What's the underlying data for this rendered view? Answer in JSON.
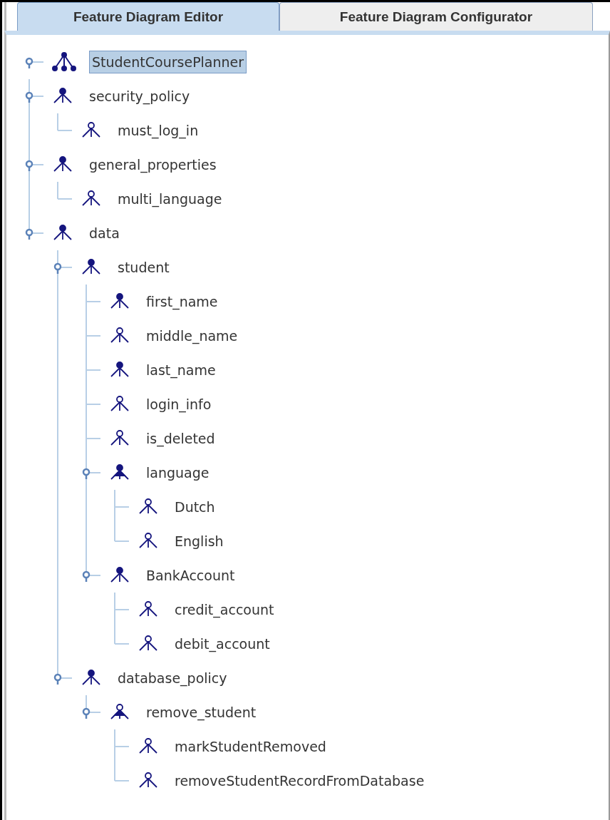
{
  "tabs": [
    {
      "label": "Feature Diagram Editor",
      "selected": true
    },
    {
      "label": "Feature Diagram Configurator",
      "selected": false
    }
  ],
  "tree": {
    "label": "StudentCoursePlanner",
    "kind": "concept",
    "selected": true,
    "expanded": true,
    "children": [
      {
        "label": "security_policy",
        "kind": "mandatory",
        "selected": false,
        "expanded": true,
        "children": [
          {
            "label": "must_log_in",
            "kind": "optional",
            "selected": false
          }
        ]
      },
      {
        "label": "general_properties",
        "kind": "mandatory",
        "selected": false,
        "expanded": true,
        "children": [
          {
            "label": "multi_language",
            "kind": "optional",
            "selected": false
          }
        ]
      },
      {
        "label": "data",
        "kind": "mandatory",
        "selected": false,
        "expanded": true,
        "children": [
          {
            "label": "student",
            "kind": "mandatory",
            "selected": false,
            "expanded": true,
            "children": [
              {
                "label": "first_name",
                "kind": "mandatory",
                "selected": false
              },
              {
                "label": "middle_name",
                "kind": "optional",
                "selected": false
              },
              {
                "label": "last_name",
                "kind": "mandatory",
                "selected": false
              },
              {
                "label": "login_info",
                "kind": "optional",
                "selected": false
              },
              {
                "label": "is_deleted",
                "kind": "optional",
                "selected": false
              },
              {
                "label": "language",
                "kind": "mandatory-or",
                "selected": false,
                "expanded": true,
                "children": [
                  {
                    "label": "Dutch",
                    "kind": "optional",
                    "selected": false
                  },
                  {
                    "label": "English",
                    "kind": "optional",
                    "selected": false
                  }
                ]
              },
              {
                "label": "BankAccount",
                "kind": "mandatory",
                "selected": false,
                "expanded": true,
                "children": [
                  {
                    "label": "credit_account",
                    "kind": "optional",
                    "selected": false
                  },
                  {
                    "label": "debit_account",
                    "kind": "optional",
                    "selected": false
                  }
                ]
              }
            ]
          },
          {
            "label": "database_policy",
            "kind": "mandatory",
            "selected": false,
            "expanded": true,
            "children": [
              {
                "label": "remove_student",
                "kind": "optional-or",
                "selected": false,
                "expanded": true,
                "children": [
                  {
                    "label": "markStudentRemoved",
                    "kind": "optional",
                    "selected": false
                  },
                  {
                    "label": "removeStudentRecordFromDatabase",
                    "kind": "optional",
                    "selected": false
                  }
                ]
              }
            ]
          }
        ]
      }
    ]
  }
}
